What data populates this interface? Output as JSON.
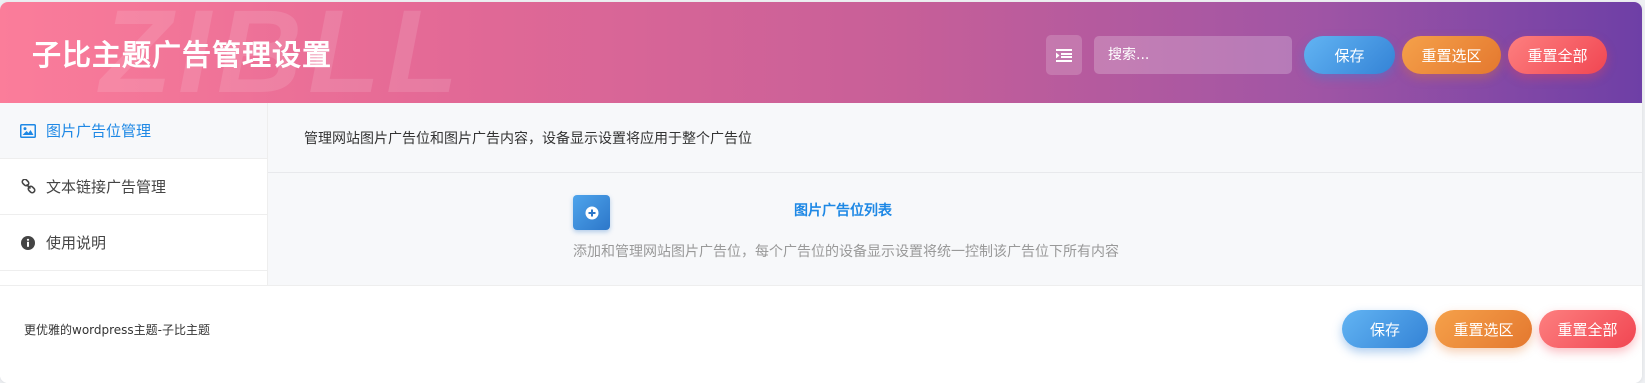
{
  "header": {
    "title": "子比主题广告管理设置",
    "watermark": "ZIBLL",
    "search_placeholder": "搜索...",
    "save_label": "保存",
    "reset_section_label": "重置选区",
    "reset_all_label": "重置全部"
  },
  "sidebar": {
    "items": [
      {
        "label": "图片广告位管理",
        "icon": "image-icon",
        "active": true
      },
      {
        "label": "文本链接广告管理",
        "icon": "link-icon",
        "active": false
      },
      {
        "label": "使用说明",
        "icon": "info-icon",
        "active": false
      }
    ]
  },
  "main": {
    "description": "管理网站图片广告位和图片广告内容，设备显示设置将应用于整个广告位",
    "field": {
      "label": "图片广告位列表",
      "add_icon": "plus-circle-icon",
      "help": "添加和管理网站图片广告位，每个广告位的设备显示设置将统一控制该广告位下所有内容"
    }
  },
  "footer": {
    "text": "更优雅的wordpress主题-子比主题",
    "save_label": "保存",
    "reset_section_label": "重置选区",
    "reset_all_label": "重置全部"
  },
  "colors": {
    "accent": "#1e88e5",
    "save": "#3483d6",
    "reset_section": "#e4782f",
    "reset_all": "#f14652"
  }
}
